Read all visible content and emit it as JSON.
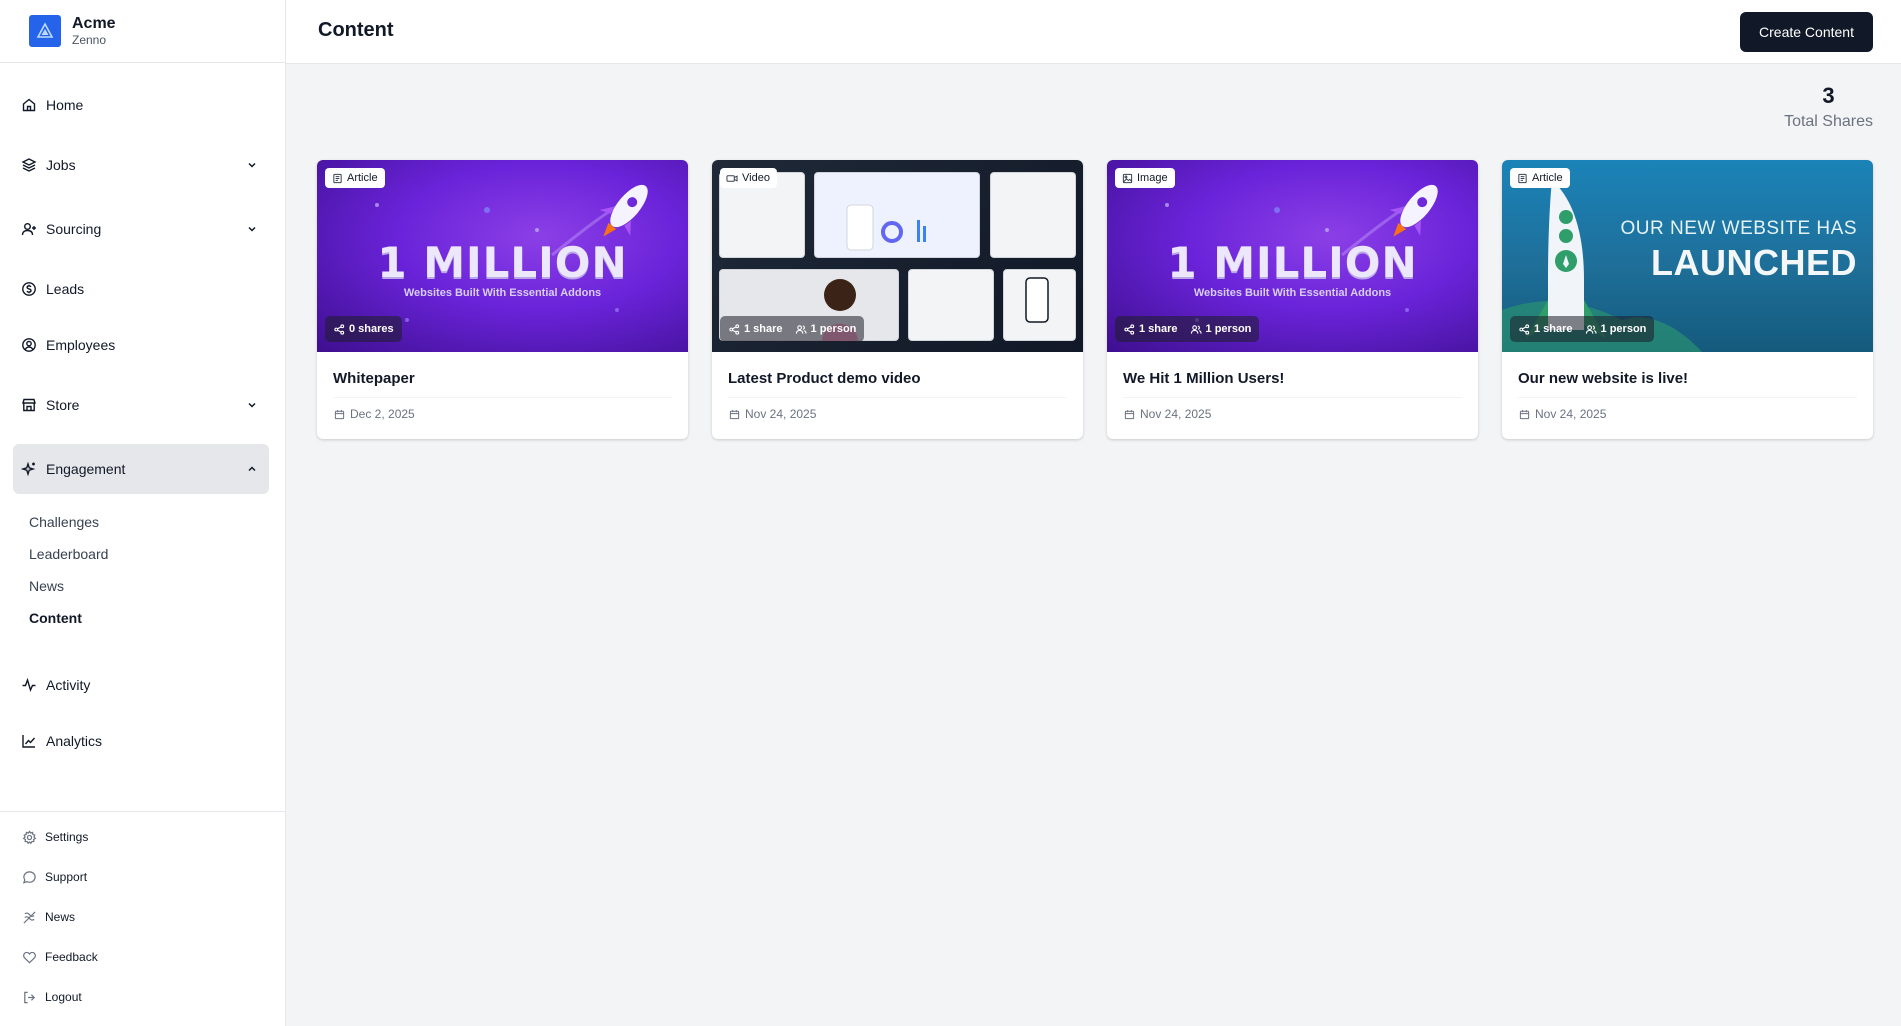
{
  "brand": {
    "name": "Acme",
    "sub": "Zenno",
    "logo_icon": "triangle-logo-icon",
    "color": "#2563eb"
  },
  "sidebar": {
    "items": [
      {
        "label": "Home",
        "icon": "home-icon"
      },
      {
        "label": "Jobs",
        "icon": "layers-icon"
      },
      {
        "label": "Sourcing",
        "icon": "user-plus-icon"
      },
      {
        "label": "Leads",
        "icon": "dollar-circle-icon"
      },
      {
        "label": "Employees",
        "icon": "user-circle-icon"
      },
      {
        "label": "Store",
        "icon": "store-icon"
      },
      {
        "label": "Engagement",
        "icon": "sparkles-icon"
      },
      {
        "label": "Activity",
        "icon": "activity-icon"
      },
      {
        "label": "Analytics",
        "icon": "line-chart-icon"
      }
    ],
    "engagement_sub": [
      {
        "label": "Challenges"
      },
      {
        "label": "Leaderboard"
      },
      {
        "label": "News"
      },
      {
        "label": "Content"
      }
    ],
    "bottom": [
      {
        "label": "Settings",
        "icon": "gear-icon"
      },
      {
        "label": "Support",
        "icon": "chat-bubble-icon"
      },
      {
        "label": "News",
        "icon": "newspaper-icon"
      },
      {
        "label": "Feedback",
        "icon": "heart-icon"
      },
      {
        "label": "Logout",
        "icon": "logout-icon"
      }
    ]
  },
  "header": {
    "title": "Content",
    "create_label": "Create Content"
  },
  "stats": {
    "value": "3",
    "label": "Total Shares"
  },
  "cards": [
    {
      "type": "Article",
      "shares": "0 shares",
      "people": "",
      "title": "Whitepaper",
      "date": "Dec 2, 2025",
      "thumb": {
        "line1": "1 MILLION",
        "line2": "Websites Built With Essential Addons"
      }
    },
    {
      "type": "Video",
      "shares": "1 share",
      "people": "1 person",
      "title": "Latest Product demo video",
      "date": "Nov 24, 2025"
    },
    {
      "type": "Image",
      "shares": "1 share",
      "people": "1 person",
      "title": "We Hit 1 Million Users!",
      "date": "Nov 24, 2025",
      "thumb": {
        "line1": "1 MILLION",
        "line2": "Websites Built With Essential Addons"
      }
    },
    {
      "type": "Article",
      "shares": "1 share",
      "people": "1 person",
      "title": "Our new website is live!",
      "date": "Nov 24, 2025",
      "thumb": {
        "line1": "OUR NEW WEBSITE HAS",
        "line2": "LAUNCHED"
      }
    }
  ],
  "colors": {
    "primary_button": "#111827",
    "active_nav": "#e5e7eb",
    "background": "#f3f4f6"
  }
}
